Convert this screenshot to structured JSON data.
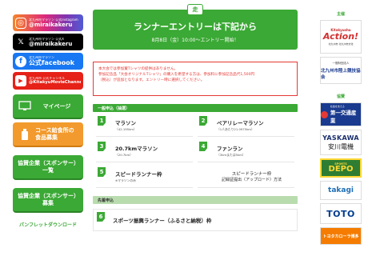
{
  "sidebar": {
    "instagram": {
      "sub": "北九州市マラソン 公式Instagram",
      "handle": "@miraikakeru"
    },
    "x": {
      "sub": "北九州市マラソン 公式X",
      "handle": "@miraikakeru"
    },
    "facebook": {
      "sub": "北九州市マラソン",
      "label": "公式facebook"
    },
    "youtube": {
      "sub": "北九州市 公式チャンネル",
      "handle": "@KitakyuMovieChannel"
    },
    "menu": {
      "mypage": "マイページ",
      "food": {
        "line1": "コース給食所の",
        "line2": "食品募集"
      },
      "sponsor_list": {
        "line1": "協賛企業（スポンサー）",
        "line2": "一覧"
      },
      "sponsor_recruit": {
        "line1": "協賛企業（スポンサー）",
        "line2": "募集"
      }
    },
    "pamphlet": "パンフレットダウンロード"
  },
  "hero": {
    "logo": "走",
    "title": "ランナーエントリーは下記から",
    "date": "8月8日（金）10:00〜エントリー開始！"
  },
  "notice": {
    "line1": "本大会では参加賞Tシャツの提供はありません。",
    "line2": "参加記念品「大会オリジナルTシャツ」の購入を希望する方は、参加料に参加記念品代1,500円",
    "line3": "（税込）が追加となります。エントリー時に選択してください。"
  },
  "general": {
    "heading": "一般申込（抽選）",
    "items": [
      {
        "num": "1",
        "title": "マラソン",
        "sub": "（42.195km）"
      },
      {
        "num": "2",
        "title": "ペアリレーマラソン",
        "sub": "（1人あたり21.0975km）"
      },
      {
        "num": "3",
        "title": "20.7kmマラソン",
        "sub": "（20.7km）"
      },
      {
        "num": "4",
        "title": "ファンラン",
        "sub": "（3kmまたは5km）"
      },
      {
        "num": "5",
        "title": "スピードランナー枠",
        "sub": "※マラソンのみ"
      }
    ],
    "speed_method": {
      "line1": "スピードランナー枠",
      "line2": "記録証提出（アップロード）方法"
    }
  },
  "priority": {
    "heading": "先着申込",
    "item": {
      "num": "6",
      "title": "スポーツ振興ランナー（ふるさと納税）枠"
    }
  },
  "sponsors": {
    "main_label": "主催",
    "action": {
      "top": "Kitakyushu",
      "name": "Action!",
      "bottom": "北九州市 北九州市文化"
    },
    "assoc": {
      "line1": "一般財団法人",
      "line2": "北九州市陸上競技協会"
    },
    "support_label": "協賛",
    "daiichi": {
      "small": "社会を支える",
      "name": "第一交通産業"
    },
    "yaskawa": {
      "en": "YASKAWA",
      "ja": "安川電機"
    },
    "depo": {
      "small": "SPORTS",
      "name": "DEPO"
    },
    "takagi": "takagi",
    "toto": "TOTO",
    "toyota": "トヨタカローラ博多"
  }
}
